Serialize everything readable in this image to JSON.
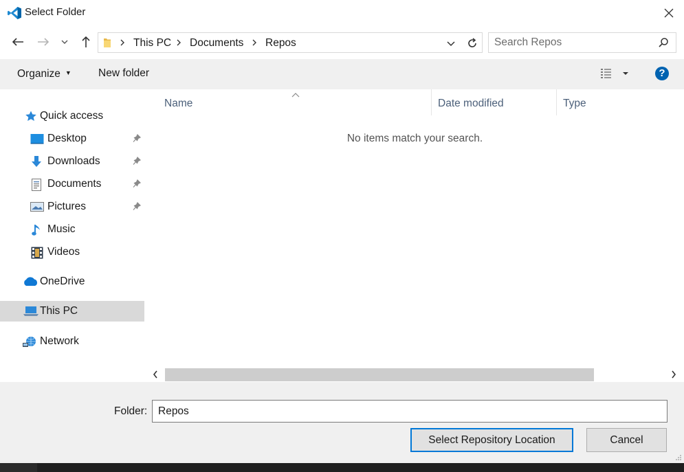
{
  "window": {
    "title": "Select Folder",
    "app_icon": "vscode-icon",
    "close_icon": "close-icon"
  },
  "nav": {
    "back_icon": "back-arrow-icon",
    "forward_icon": "forward-arrow-icon",
    "recent_icon": "chevron-down-icon",
    "up_icon": "up-arrow-icon",
    "breadcrumbs": [
      "This PC",
      "Documents",
      "Repos"
    ],
    "search_placeholder": "Search Repos"
  },
  "commands": {
    "organize": "Organize",
    "new_folder": "New folder",
    "help": "?"
  },
  "sidebar": {
    "items": [
      {
        "label": "Quick access",
        "icon": "star-icon",
        "pinned": false
      },
      {
        "label": "Desktop",
        "icon": "desktop-icon",
        "pinned": true
      },
      {
        "label": "Downloads",
        "icon": "download-icon",
        "pinned": true
      },
      {
        "label": "Documents",
        "icon": "documents-icon",
        "pinned": true
      },
      {
        "label": "Pictures",
        "icon": "pictures-icon",
        "pinned": true
      },
      {
        "label": "Music",
        "icon": "music-icon",
        "pinned": false
      },
      {
        "label": "Videos",
        "icon": "videos-icon",
        "pinned": false
      },
      {
        "label": "OneDrive",
        "icon": "cloud-icon",
        "pinned": false
      },
      {
        "label": "This PC",
        "icon": "computer-icon",
        "pinned": false,
        "selected": true
      },
      {
        "label": "Network",
        "icon": "network-icon",
        "pinned": false
      }
    ]
  },
  "list": {
    "columns": [
      "Name",
      "Date modified",
      "Type"
    ],
    "empty_message": "No items match your search."
  },
  "footer": {
    "folder_label": "Folder:",
    "folder_value": "Repos",
    "select_button": "Select Repository Location",
    "cancel_button": "Cancel"
  },
  "colors": {
    "accent": "#0078d7",
    "selection": "#d9d9d9",
    "toolbar_bg": "#f0f0f0"
  }
}
